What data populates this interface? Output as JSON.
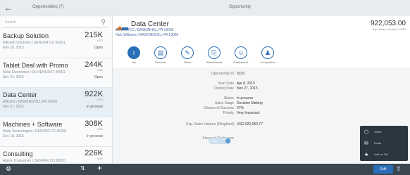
{
  "topbar": {
    "back_icon": "back-arrow-icon",
    "list_title": "Opportunities (7)",
    "detail_title": "Opportunity"
  },
  "master": {
    "search_placeholder": "Search",
    "items": [
      {
        "title": "Backup Solution",
        "amount": "215K",
        "currency": "USD",
        "line1": "Efficient Solutions / DENVER CO 80201",
        "line2": "Nov 18, 2015",
        "status": "Open"
      },
      {
        "title": "Tablet Deal with Promo",
        "amount": "244K",
        "currency": "USD",
        "line1": "Nelle Electronics / OLIVEHURST 95961",
        "line2": "Nov 24, 2015",
        "status": "Open"
      },
      {
        "title": "Data Center",
        "amount": "922K",
        "currency": "USD",
        "line1": "Efficient / BASKINGHILL PA 19006",
        "line2": "Nov 27, 2015",
        "status": "In process"
      },
      {
        "title": "Machines + Software",
        "amount": "308K",
        "currency": "USD",
        "line1": "Nelle Technologies / DENVER CO 80201",
        "line2": "Dec 18, 2015",
        "status": "In process"
      },
      {
        "title": "Consulting",
        "amount": "226K",
        "currency": "USD",
        "line1": "Alpine Tradesmen / DENVER CO 80201",
        "line2": "",
        "status": ""
      }
    ]
  },
  "detail": {
    "title": "Data Center",
    "amount": "922,053.00",
    "amount_label": "Exp. Sales Volume in USD",
    "account": "EDVANTEC / BASKINHILL PA 19006",
    "contact": "Nick Williams / BASKINGHILL PA 19006",
    "tabs": [
      {
        "label": "Info",
        "icon": "info-icon"
      },
      {
        "label": "Products",
        "icon": "products-icon"
      },
      {
        "label": "Notes",
        "icon": "notes-icon"
      },
      {
        "label": "Attachments",
        "icon": "attachment-icon"
      },
      {
        "label": "Participants",
        "icon": "participants-icon"
      },
      {
        "label": "Competitors",
        "icon": "competitors-icon"
      }
    ],
    "fields": [
      {
        "label": "Opportunity ID",
        "value": "5315"
      },
      {
        "label": "Start Date",
        "value": "Apr 8, 2015"
      },
      {
        "label": "Closing Date",
        "value": "Nov 27, 2015"
      },
      {
        "label": "Status",
        "value": "In process"
      },
      {
        "label": "Sales Stage",
        "value": "Decision Making"
      },
      {
        "label": "Chance of Success",
        "value": "67%"
      },
      {
        "label": "Priority",
        "value": "Very Important"
      },
      {
        "label": "Exp. Sales Volume (Weighted)",
        "value": "USD 922,053.77"
      },
      {
        "label": "Forecast Relevance",
        "value": "Yes"
      }
    ]
  },
  "menu": [
    {
      "icon": "share-icon",
      "label": "Share"
    },
    {
      "icon": "mail-icon",
      "label": "Email"
    },
    {
      "icon": "favorite-icon",
      "label": "Add as Tile"
    }
  ],
  "bottombar": {
    "gear_icon": "gear-icon",
    "filter_icon": "filter-icon",
    "add_icon": "add-icon",
    "main_button": "Edit",
    "share_icon": "share-icon"
  }
}
